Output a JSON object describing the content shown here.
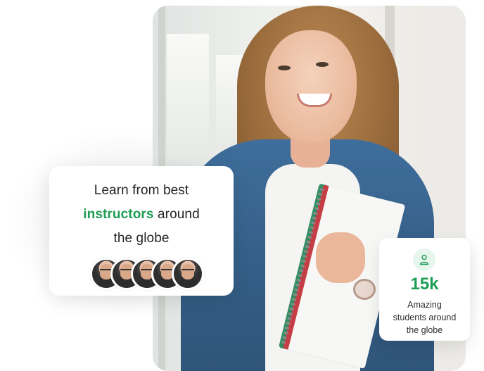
{
  "hero": {
    "photo_icon": "student-photo"
  },
  "left_card": {
    "line1": "Learn from best",
    "accent": "instructors",
    "line2_rest": " around",
    "line3": "the globe",
    "avatar_count": 5,
    "accent_color": "#1f9d55"
  },
  "right_card": {
    "icon": "user-icon",
    "number": "15k",
    "label_line1": "Amazing",
    "label_line2": "students around",
    "label_line3": "the globe",
    "accent_color": "#1f9d55"
  }
}
